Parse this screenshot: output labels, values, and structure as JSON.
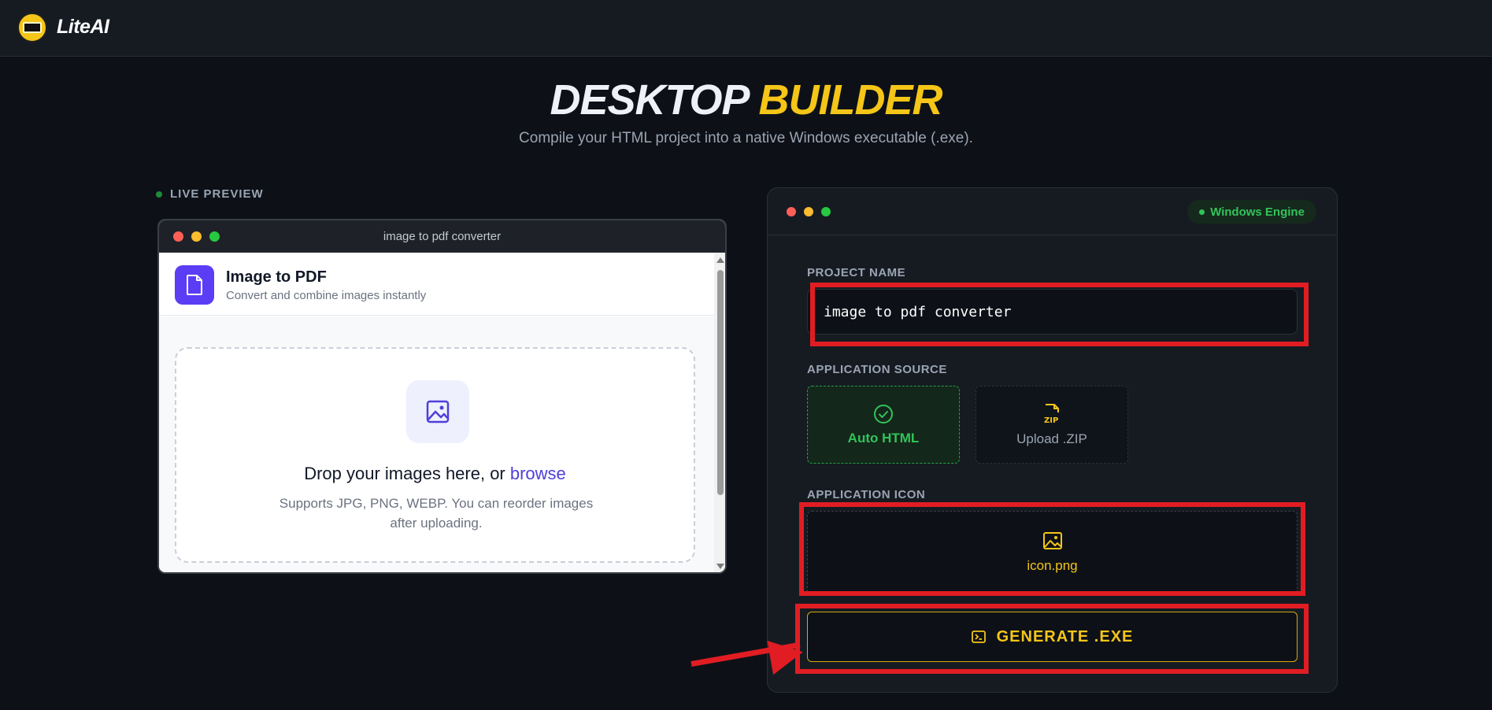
{
  "brand": {
    "name": "LiteAI"
  },
  "hero": {
    "title_white": "DESKTOP",
    "title_yellow": "BUILDER",
    "subtitle": "Compile your HTML project into a native Windows executable (.exe)."
  },
  "preview": {
    "label": "LIVE PREVIEW",
    "window_title": "image to pdf converter",
    "app_name": "Image to PDF",
    "app_desc": "Convert and combine images instantly",
    "drop_title_prefix": "Drop your images here, or ",
    "drop_title_link": "browse",
    "drop_hint": "Supports JPG, PNG, WEBP. You can reorder images after uploading."
  },
  "builder": {
    "engine_badge": "Windows Engine",
    "project_name_label": "PROJECT NAME",
    "project_name_value": "image to pdf converter",
    "source_label": "APPLICATION SOURCE",
    "source_options": [
      {
        "label": "Auto HTML",
        "icon": "check-circle-icon",
        "selected": true
      },
      {
        "label": "Upload .ZIP",
        "icon": "zip-file-icon",
        "selected": false
      }
    ],
    "icon_label": "APPLICATION ICON",
    "icon_file": "icon.png",
    "generate_label": "GENERATE .EXE"
  },
  "colors": {
    "accent_yellow": "#f5c518",
    "accent_green": "#32c35a",
    "annotation_red": "#e11d23",
    "app_purple": "#5b3df5"
  }
}
